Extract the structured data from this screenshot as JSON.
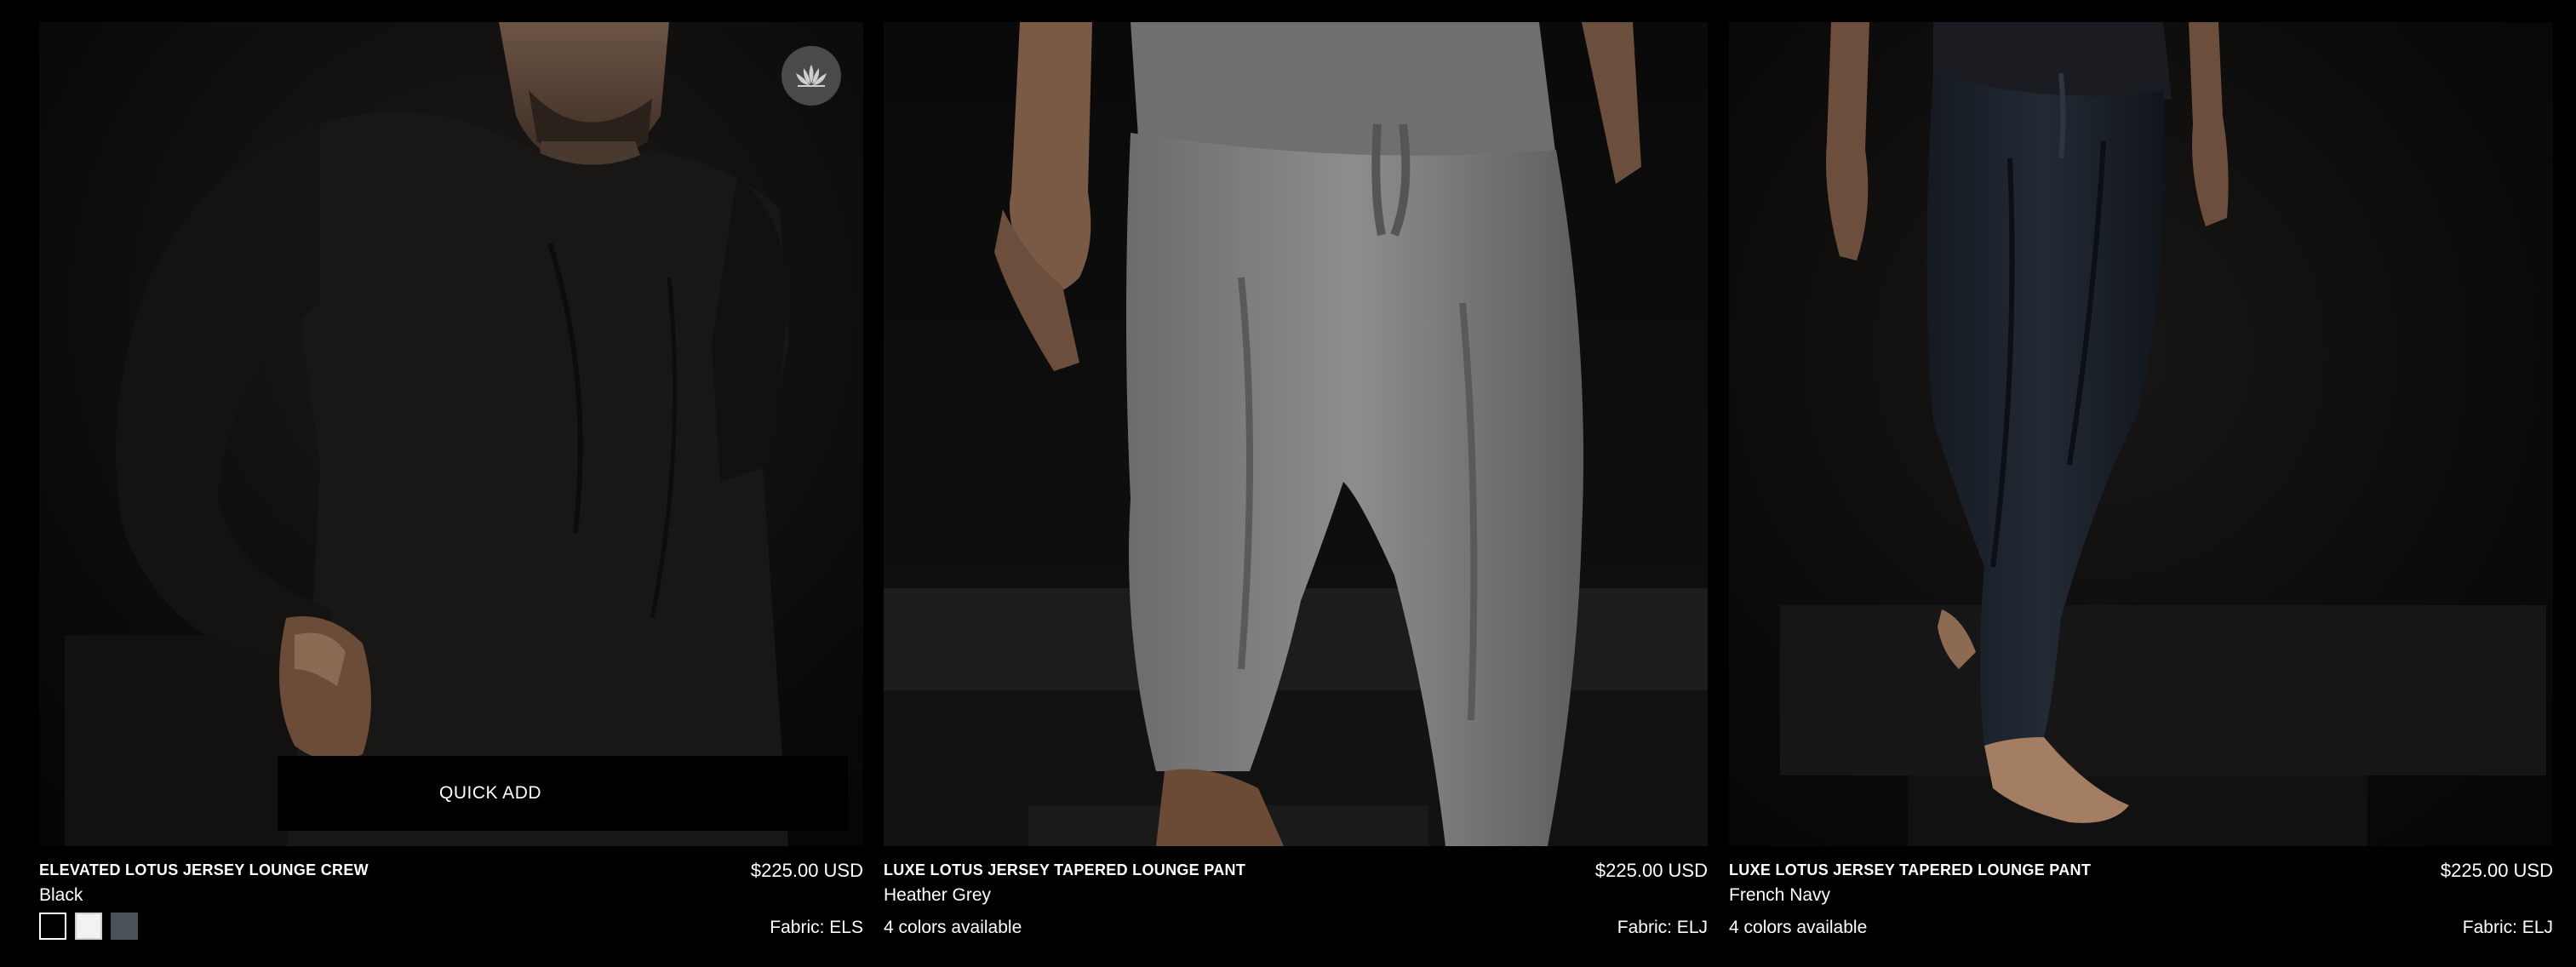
{
  "products": [
    {
      "title": "ELEVATED LOTUS JERSEY LOUNGE CREW",
      "color_name": "Black",
      "price": "$225.00 USD",
      "fabric": "Fabric: ELS",
      "quick_add_label": "QUICK ADD",
      "badge_icon": "lotus-icon",
      "swatches": [
        {
          "name": "Black",
          "color": "#000000",
          "border": "#ffffff"
        },
        {
          "name": "White",
          "color": "#f2f2f2",
          "border": "#cfcfcf"
        },
        {
          "name": "Grey",
          "color": "#4c525a",
          "border": "#4c525a"
        }
      ]
    },
    {
      "title": "LUXE LOTUS JERSEY TAPERED LOUNGE PANT",
      "color_name": "Heather Grey",
      "price": "$225.00 USD",
      "fabric": "Fabric: ELJ",
      "colors_available": "4 colors available"
    },
    {
      "title": "LUXE LOTUS JERSEY TAPERED LOUNGE PANT",
      "color_name": "French Navy",
      "price": "$225.00 USD",
      "fabric": "Fabric: ELJ",
      "colors_available": "4 colors available"
    }
  ],
  "colors": {
    "background": "#000000",
    "text": "#ffffff",
    "badge": "#4a4a4a"
  }
}
